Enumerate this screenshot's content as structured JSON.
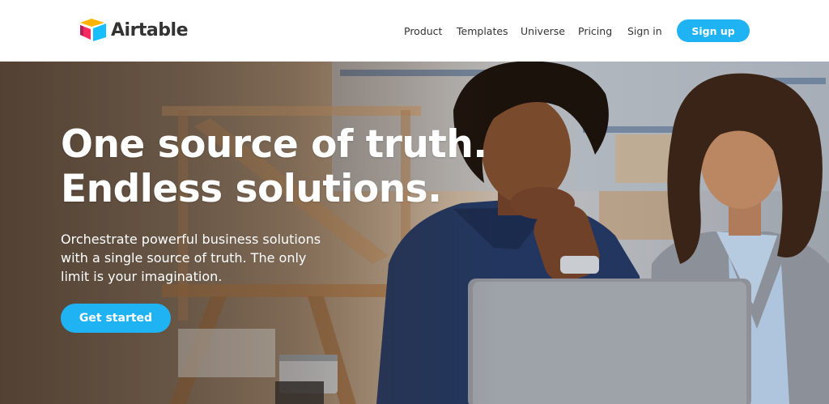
{
  "brand": {
    "name": "Airtable",
    "logo_icon": "airtable-logo-icon",
    "logo_colors": [
      "#fcb400",
      "#18bfff",
      "#f82b60"
    ]
  },
  "nav": {
    "items": [
      {
        "label": "Product"
      },
      {
        "label": "Templates"
      },
      {
        "label": "Universe"
      },
      {
        "label": "Pricing"
      },
      {
        "label": "Sign in"
      }
    ],
    "signup_label": "Sign up"
  },
  "hero": {
    "title_line1": "One source of truth.",
    "title_line2": "Endless solutions.",
    "subtitle": "Orchestrate powerful business solutions with a single source of truth. The only limit is your imagination.",
    "cta_label": "Get started",
    "image": "hero-photo-two-women-laptop"
  },
  "colors": {
    "accent": "#20b3f3",
    "text_dark": "#333333",
    "white": "#ffffff"
  }
}
